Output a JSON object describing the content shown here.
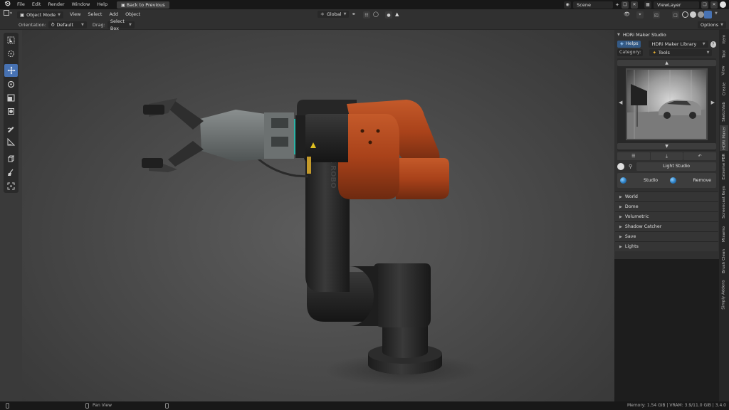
{
  "topbar": {
    "menu": [
      "File",
      "Edit",
      "Render",
      "Window",
      "Help"
    ],
    "back_button": "Back to Previous",
    "scene": "Scene",
    "view_layer": "ViewLayer"
  },
  "header": {
    "mode": "Object Mode",
    "menus": [
      "View",
      "Select",
      "Add",
      "Object"
    ],
    "transform_orientation": "Global",
    "options": "Options"
  },
  "toolbar2": {
    "orientation_label": "Orientation:",
    "orientation_value": "Default",
    "drag_label": "Drag:",
    "drag_value": "Select Box"
  },
  "npanel": {
    "title": "HDRi Maker Studio",
    "helps": "Helps",
    "library": "HDRi Maker Library",
    "category_label": "Category:",
    "category_value": "Tools",
    "light_studio": "Light Studio",
    "studio_button": "Studio",
    "remove_button": "Remove",
    "sections": [
      "World",
      "Dome",
      "Volumetric",
      "Shadow Catcher",
      "Save",
      "Lights"
    ]
  },
  "vtabs": [
    "Item",
    "Tool",
    "View",
    "Create",
    "Sketchfab",
    "HDRi Maker",
    "Extreme PBR",
    "Screencast Keys",
    "Mixamo",
    "Brush Clean",
    "Simply Addons"
  ],
  "robot": {
    "label": "BLACK ROBO"
  },
  "status": {
    "action": "Pan View",
    "memory": "Memory: 1.54 GiB | VRAM: 3.9/11.0 GiB | 3.4.0"
  },
  "colors": {
    "accent": "#4772b3",
    "robot_orange": "#b84a1c",
    "robot_black": "#2a2a2a"
  }
}
